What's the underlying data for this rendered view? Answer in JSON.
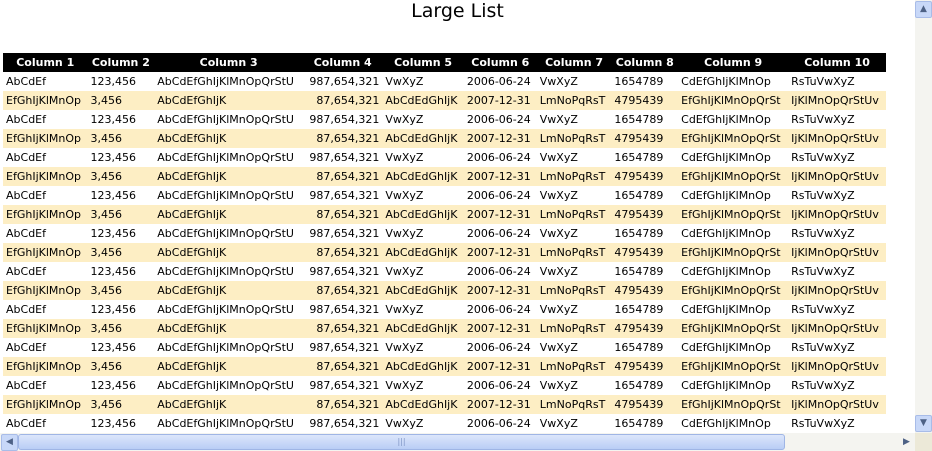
{
  "title": "Large List",
  "columns": [
    "Column 1",
    "Column 2",
    "Column 3",
    "Column 4",
    "Column 5",
    "Column 6",
    "Column 7",
    "Column 8",
    "Column 9",
    "Column 10"
  ],
  "right_aligned": [
    3
  ],
  "row_patterns": [
    [
      "AbCdEf",
      "123,456",
      "AbCdEfGhIjKlMnOpQrStU",
      "987,654,321",
      "VwXyZ",
      "2006-06-24",
      "VwXyZ",
      "1654789",
      "CdEfGhIjKlMnOp",
      "RsTuVwXyZ"
    ],
    [
      "EfGhIjKlMnOp",
      "3,456",
      "AbCdEfGhIjK",
      "87,654,321",
      "AbCdEdGhIjK",
      "2007-12-31",
      "LmNoPqRsT",
      "4795439",
      "EfGhIjKlMnOpQrSt",
      "IjKlMnOpQrStUv"
    ]
  ],
  "visible_row_count": 19,
  "colors": {
    "header_bg": "#000000",
    "header_text": "#ffffff",
    "alt_row": "#fdeec4"
  },
  "scrollbars": {
    "vertical": {
      "up": "up-arrow-icon",
      "down": "down-arrow-icon"
    },
    "horizontal": {
      "left": "left-arrow-icon",
      "right": "right-arrow-icon",
      "grip": "|||"
    }
  }
}
